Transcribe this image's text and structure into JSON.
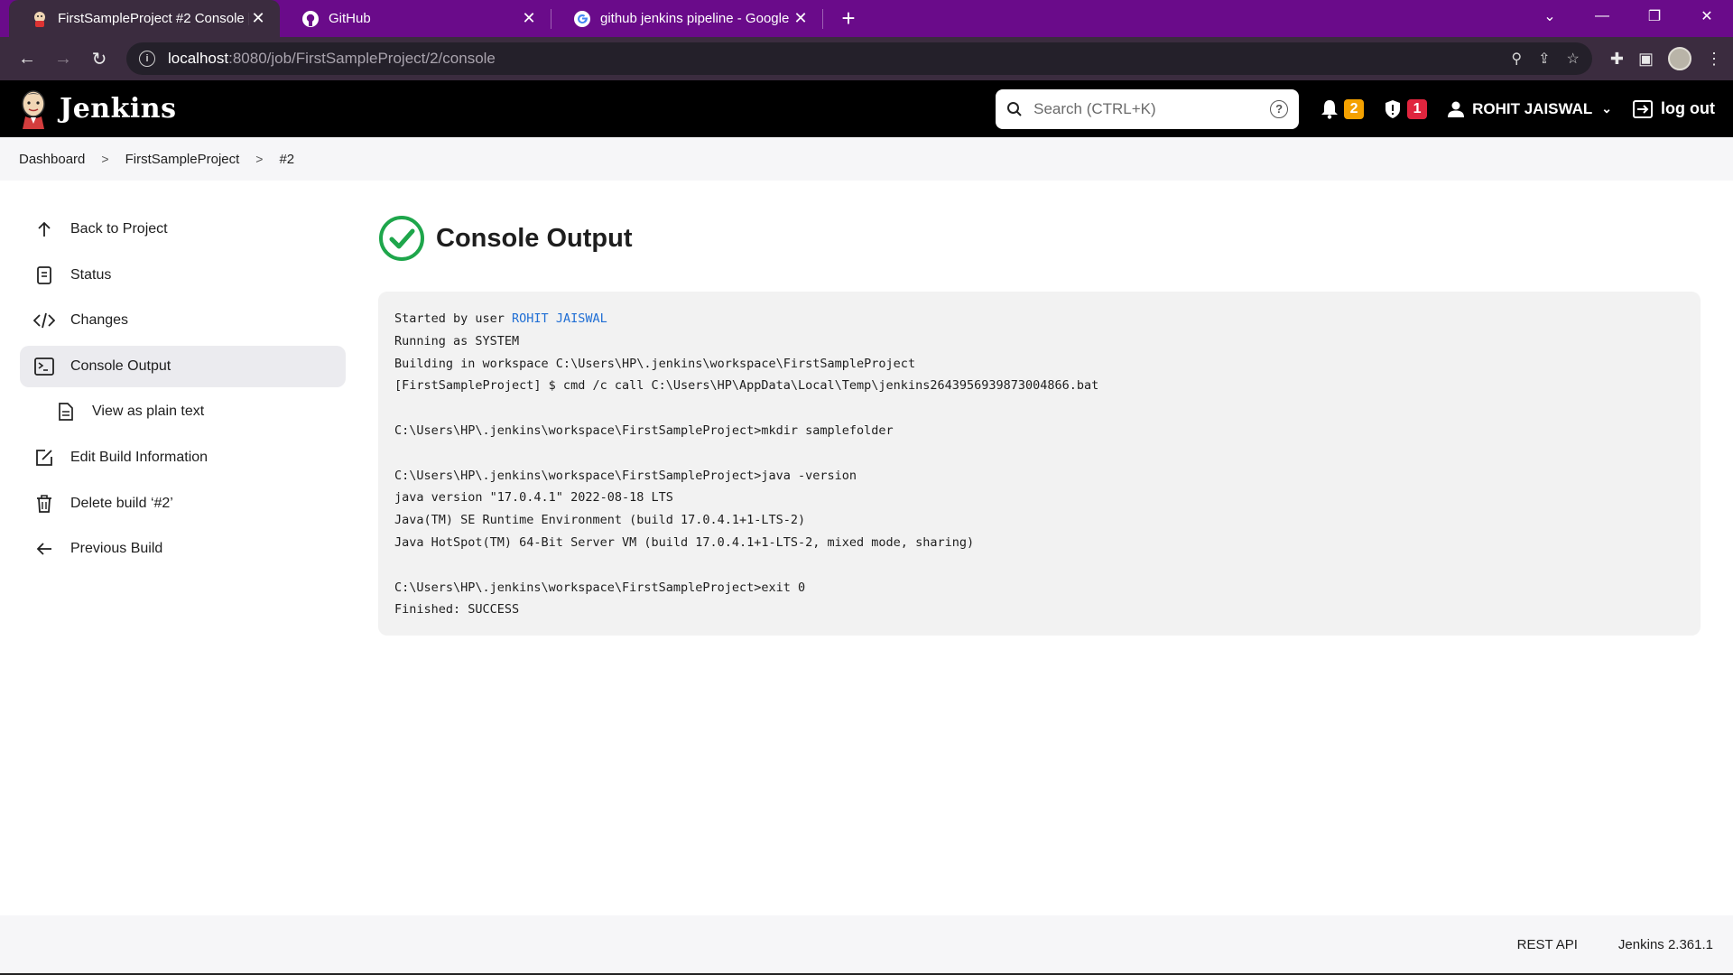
{
  "browser": {
    "tabs": [
      {
        "title": "FirstSampleProject #2 Console [Jenkins]",
        "icon": "jenkins-favicon",
        "active": true
      },
      {
        "title": "GitHub",
        "icon": "github-icon",
        "active": false
      },
      {
        "title": "github jenkins pipeline - Google Search",
        "icon": "google-icon",
        "active": false
      }
    ],
    "url_host": "localhost",
    "url_path": ":8080/job/FirstSampleProject/2/console"
  },
  "header": {
    "logo_text": "Jenkins",
    "search_placeholder": "Search (CTRL+K)",
    "notifications_count": "2",
    "security_count": "1",
    "user_name": "ROHIT JAISWAL",
    "logout_label": "log out"
  },
  "breadcrumb": {
    "items": [
      "Dashboard",
      "FirstSampleProject",
      "#2"
    ]
  },
  "sidebar": {
    "items": [
      {
        "label": "Back to Project",
        "icon": "arrow-up-icon"
      },
      {
        "label": "Status",
        "icon": "document-icon"
      },
      {
        "label": "Changes",
        "icon": "code-icon"
      },
      {
        "label": "Console Output",
        "icon": "terminal-icon"
      },
      {
        "label": "View as plain text",
        "icon": "file-text-icon"
      },
      {
        "label": "Edit Build Information",
        "icon": "edit-icon"
      },
      {
        "label": "Delete build ‘#2’",
        "icon": "trash-icon"
      },
      {
        "label": "Previous Build",
        "icon": "arrow-left-icon"
      }
    ]
  },
  "main": {
    "title": "Console Output",
    "status_color": "#1ea64b",
    "console": {
      "started_prefix": "Started by user ",
      "started_user": "ROHIT JAISWAL",
      "lines": [
        "Running as SYSTEM",
        "Building in workspace C:\\Users\\HP\\.jenkins\\workspace\\FirstSampleProject",
        "[FirstSampleProject] $ cmd /c call C:\\Users\\HP\\AppData\\Local\\Temp\\jenkins2643956939873004866.bat",
        "",
        "C:\\Users\\HP\\.jenkins\\workspace\\FirstSampleProject>mkdir samplefolder",
        "",
        "C:\\Users\\HP\\.jenkins\\workspace\\FirstSampleProject>java -version",
        "java version \"17.0.4.1\" 2022-08-18 LTS",
        "Java(TM) SE Runtime Environment (build 17.0.4.1+1-LTS-2)",
        "Java HotSpot(TM) 64-Bit Server VM (build 17.0.4.1+1-LTS-2, mixed mode, sharing)",
        "",
        "C:\\Users\\HP\\.jenkins\\workspace\\FirstSampleProject>exit 0",
        "Finished: SUCCESS"
      ]
    }
  },
  "footer": {
    "rest_api": "REST API",
    "version": "Jenkins 2.361.1"
  }
}
